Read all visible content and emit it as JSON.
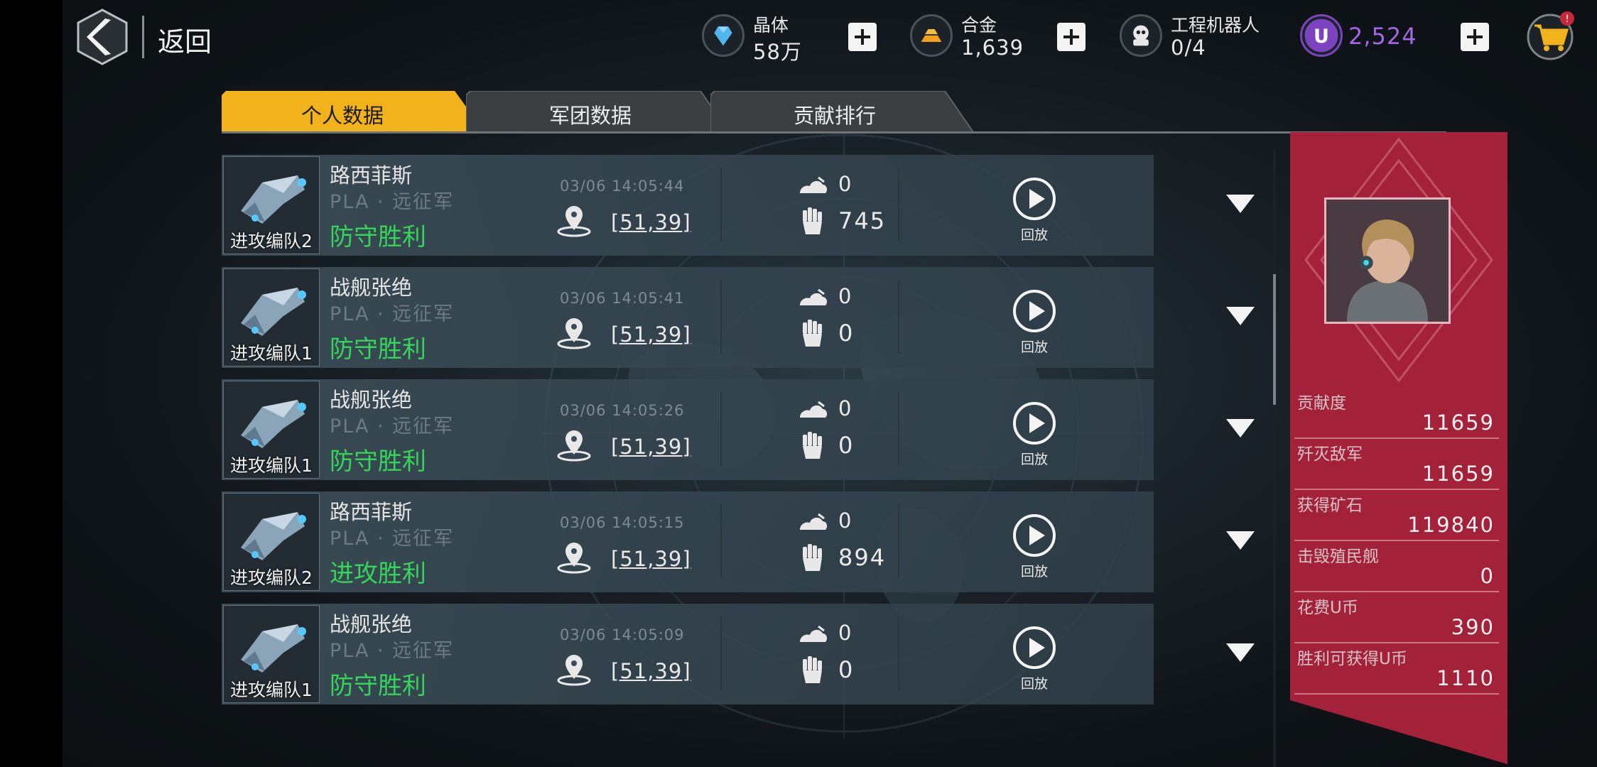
{
  "header": {
    "back_label": "返回"
  },
  "resources": [
    {
      "id": "crystal",
      "label": "晶体",
      "value": "58万",
      "icon": "crystal-icon"
    },
    {
      "id": "alloy",
      "label": "合金",
      "value": "1,639",
      "icon": "alloy-icon"
    },
    {
      "id": "robot",
      "label": "工程机器人",
      "value": "0/4",
      "icon": "robot-icon"
    },
    {
      "id": "ucoin",
      "value": "2,524",
      "icon": "u-coin-icon"
    }
  ],
  "tabs": [
    {
      "label": "个人数据",
      "active": true
    },
    {
      "label": "军团数据",
      "active": false
    },
    {
      "label": "贡献排行",
      "active": false
    }
  ],
  "records": [
    {
      "fleet": "进攻编队2",
      "name": "路西菲斯",
      "guild": "PLA · 远征军",
      "result": "防守胜利",
      "time": "03/06 14:05:44",
      "coord": "[51,39]",
      "loss": "0",
      "kills": "745",
      "replay": "回放"
    },
    {
      "fleet": "进攻编队1",
      "name": "战舰张绝",
      "guild": "PLA · 远征军",
      "result": "防守胜利",
      "time": "03/06 14:05:41",
      "coord": "[51,39]",
      "loss": "0",
      "kills": "0",
      "replay": "回放"
    },
    {
      "fleet": "进攻编队1",
      "name": "战舰张绝",
      "guild": "PLA · 远征军",
      "result": "防守胜利",
      "time": "03/06 14:05:26",
      "coord": "[51,39]",
      "loss": "0",
      "kills": "0",
      "replay": "回放"
    },
    {
      "fleet": "进攻编队2",
      "name": "路西菲斯",
      "guild": "PLA · 远征军",
      "result": "进攻胜利",
      "time": "03/06 14:05:15",
      "coord": "[51,39]",
      "loss": "0",
      "kills": "894",
      "replay": "回放"
    },
    {
      "fleet": "进攻编队1",
      "name": "战舰张绝",
      "guild": "PLA · 远征军",
      "result": "防守胜利",
      "time": "03/06 14:05:09",
      "coord": "[51,39]",
      "loss": "0",
      "kills": "0",
      "replay": "回放"
    }
  ],
  "summary": [
    {
      "label": "贡献度",
      "value": "11659"
    },
    {
      "label": "歼灭敌军",
      "value": "11659"
    },
    {
      "label": "获得矿石",
      "value": "119840"
    },
    {
      "label": "击毁殖民舰",
      "value": "0"
    },
    {
      "label": "花费U币",
      "value": "390"
    },
    {
      "label": "胜利可获得U币",
      "value": "1110"
    }
  ],
  "colors": {
    "active_tab": "#f1b21c",
    "inactive_tab": "#3b3f42",
    "result_green": "#35d45a",
    "panel_red": "#a3223a",
    "ucoin_purple": "#a266e6",
    "cart_yellow": "#f1b21c"
  }
}
